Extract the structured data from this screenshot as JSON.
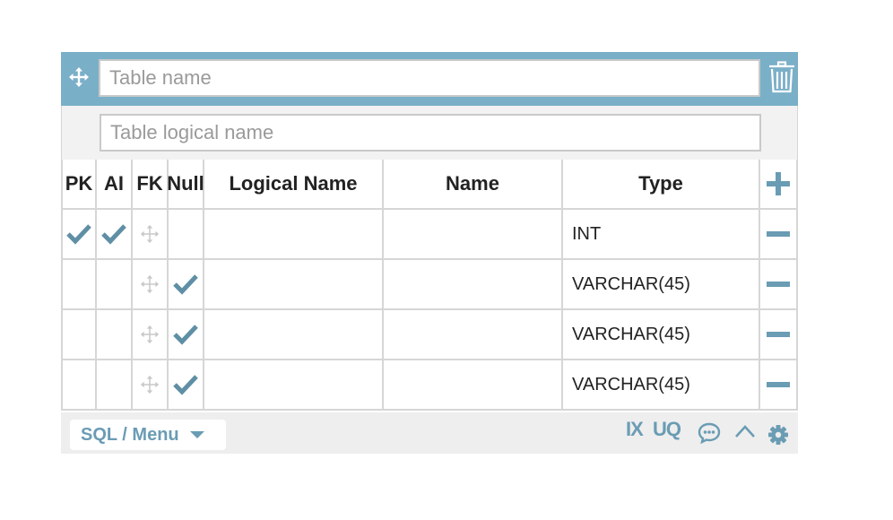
{
  "table": {
    "name_placeholder": "Table name",
    "logical_placeholder": "Table logical name"
  },
  "columns": [
    "PK",
    "AI",
    "FK",
    "Null",
    "Logical Name",
    "Name",
    "Type"
  ],
  "rows": [
    {
      "pk": true,
      "ai": true,
      "fk": "move",
      "null": false,
      "logical_name": "",
      "name": "",
      "type": "INT"
    },
    {
      "pk": false,
      "ai": false,
      "fk": "move",
      "null": true,
      "logical_name": "",
      "name": "",
      "type": "VARCHAR(45)"
    },
    {
      "pk": false,
      "ai": false,
      "fk": "move",
      "null": true,
      "logical_name": "",
      "name": "",
      "type": "VARCHAR(45)"
    },
    {
      "pk": false,
      "ai": false,
      "fk": "move",
      "null": true,
      "logical_name": "",
      "name": "",
      "type": "VARCHAR(45)"
    }
  ],
  "footer": {
    "sql_menu_label": "SQL / Menu",
    "index_label": "IX",
    "unique_label": "UQ"
  },
  "icons": {
    "move": "move-arrows-icon",
    "delete": "trash-icon",
    "add": "plus-icon",
    "remove": "minus-icon",
    "check": "checkmark-icon",
    "comment": "comment-bubble-icon",
    "collapse": "chevron-up-icon",
    "settings": "gear-icon"
  },
  "colors": {
    "header_bar": "#7aafc8",
    "accent": "#6a9cb4",
    "check": "#5f8fa5",
    "grid_line": "#d6d6d6"
  }
}
